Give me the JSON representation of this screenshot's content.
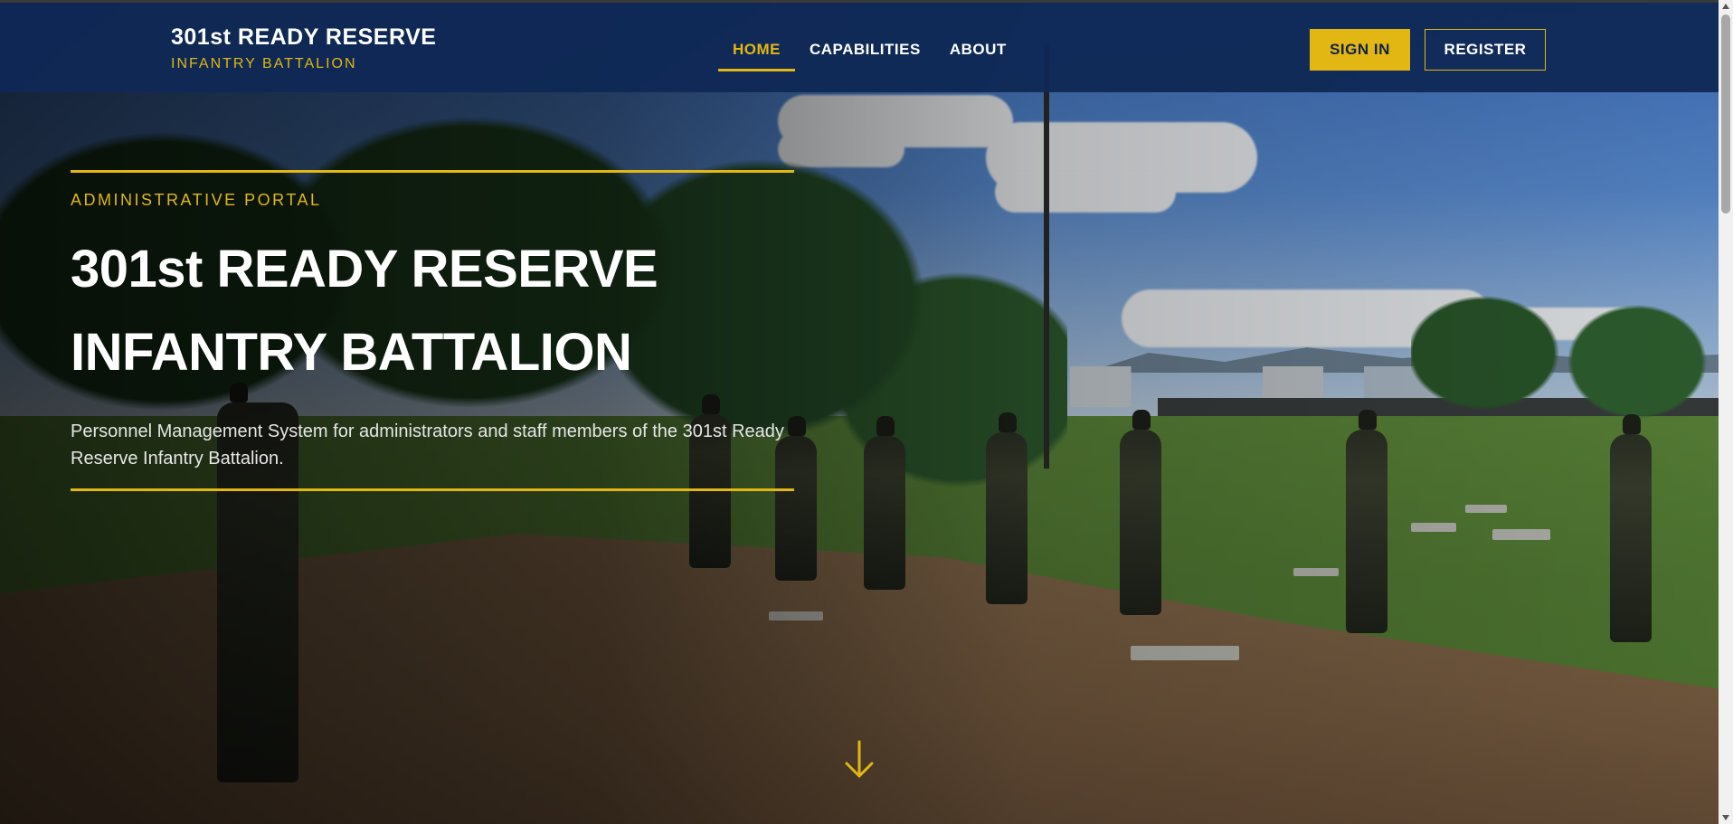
{
  "brand": {
    "title": "301st READY RESERVE",
    "subtitle": "INFANTRY BATTALION"
  },
  "nav": {
    "items": [
      {
        "label": "HOME",
        "active": true
      },
      {
        "label": "CAPABILITIES",
        "active": false
      },
      {
        "label": "ABOUT",
        "active": false
      }
    ]
  },
  "auth": {
    "signin_label": "SIGN IN",
    "register_label": "REGISTER"
  },
  "hero": {
    "eyebrow": "ADMINISTRATIVE PORTAL",
    "headline": "301st READY RESERVE INFANTRY BATTALION",
    "description": "Personnel Management System for administrators and staff members of the 301st Ready Reserve Infantry Battalion."
  },
  "icons": {
    "scroll": "arrow-down-icon"
  },
  "colors": {
    "navy": "#0f2855",
    "gold": "#e2b714",
    "white": "#ffffff"
  }
}
